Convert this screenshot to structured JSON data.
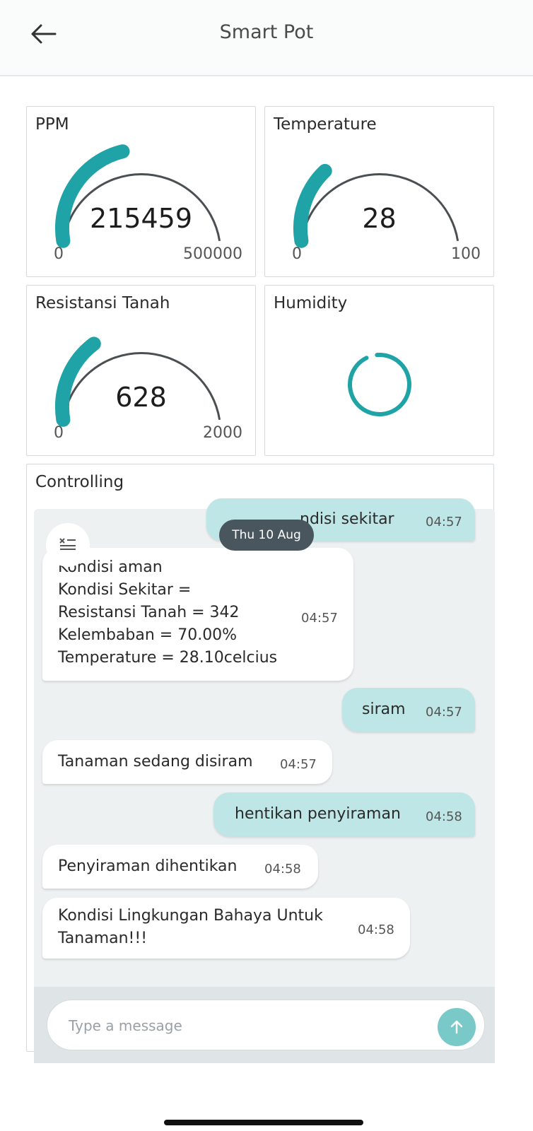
{
  "header": {
    "title": "Smart Pot",
    "back_icon": "arrow-left-icon"
  },
  "gauges": [
    {
      "title": "PPM",
      "value": "215459",
      "min": "0",
      "max": "500000",
      "fraction": 0.431
    },
    {
      "title": "Temperature",
      "value": "28",
      "min": "0",
      "max": "100",
      "fraction": 0.28
    },
    {
      "title": "Resistansi Tanah",
      "value": "628",
      "min": "0",
      "max": "2000",
      "fraction": 0.314
    }
  ],
  "humidity": {
    "title": "Humidity",
    "state": "loading"
  },
  "controlling": {
    "title": "Controlling",
    "date_pill": "Thu 10 Aug",
    "messages": [
      {
        "dir": "out",
        "text": "ndisi sekitar",
        "time": "04:57"
      },
      {
        "dir": "in",
        "text": "Kondisi aman\nKondisi Sekitar =\nResistansi Tanah = 342\nKelembaban = 70.00%\nTemperature = 28.10celcius",
        "time": "04:57"
      },
      {
        "dir": "out",
        "text": "siram",
        "time": "04:57"
      },
      {
        "dir": "in",
        "text": "Tanaman sedang disiram",
        "time": "04:57"
      },
      {
        "dir": "out",
        "text": "hentikan penyiraman",
        "time": "04:58"
      },
      {
        "dir": "in",
        "text": "Penyiraman dihentikan",
        "time": "04:58"
      },
      {
        "dir": "in",
        "text": "Kondisi Lingkungan Bahaya Untuk\nTanaman!!!",
        "time": "04:58"
      }
    ],
    "input_placeholder": "Type a message",
    "send_icon": "arrow-up-icon"
  },
  "colors": {
    "accent": "#1fa3a6",
    "track": "#4a4f52",
    "bubble_out": "#bfe6e6",
    "send": "#79c9c9"
  }
}
